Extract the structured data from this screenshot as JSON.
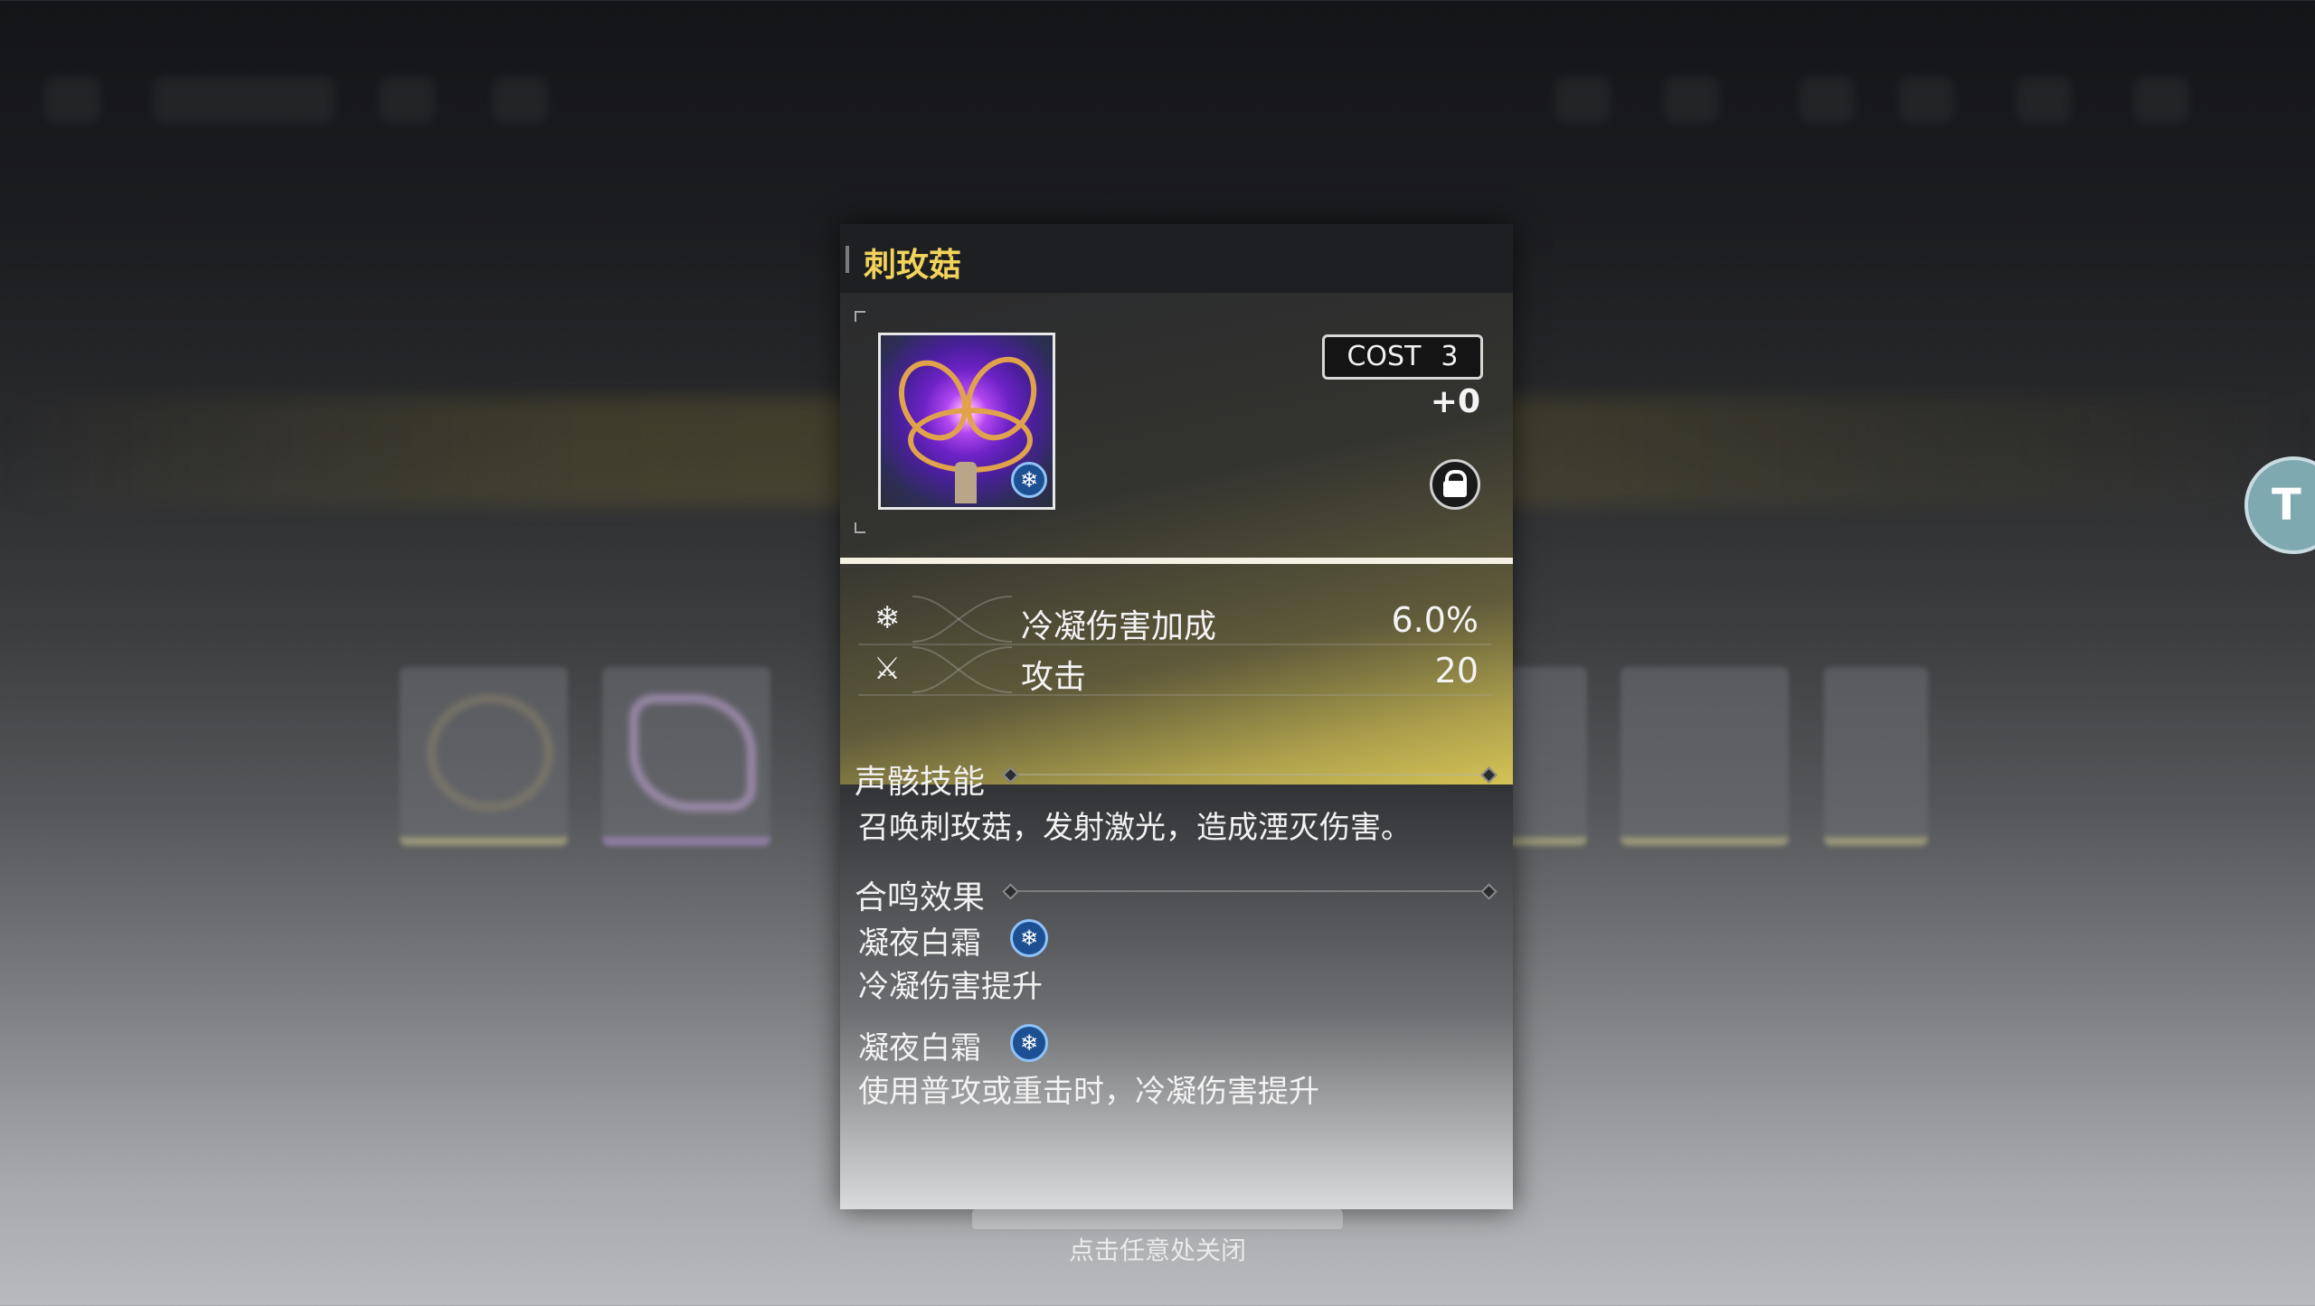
{
  "echo": {
    "name": "刺玫菇",
    "cost_label": "COST",
    "cost_value": "3",
    "level": "+0",
    "icons": {
      "element": "glacio-snowflake-icon",
      "lock": "lock-icon"
    },
    "colors": {
      "title": "#f1d25a",
      "rarity_gold": "#d4c354",
      "glacio": "#1d4f93"
    }
  },
  "stats": [
    {
      "icon": "glacio-damage-icon",
      "name": "冷凝伤害加成",
      "value": "6.0%"
    },
    {
      "icon": "attack-swords-icon",
      "name": "攻击",
      "value": "20"
    }
  ],
  "skill": {
    "title": "声骸技能",
    "description": "召唤刺玫菇，发射激光，造成湮灭伤害。"
  },
  "sonata": {
    "title": "合鸣效果",
    "effects": [
      {
        "name": "凝夜白霜",
        "description": "冷凝伤害提升",
        "icon": "glacio-snowflake-icon"
      },
      {
        "name": "凝夜白霜",
        "description": "使用普攻或重击时，冷凝伤害提升",
        "icon": "glacio-snowflake-icon"
      }
    ]
  },
  "close_hint": "点击任意处关闭",
  "background": {
    "side_button_glyph": "T"
  }
}
